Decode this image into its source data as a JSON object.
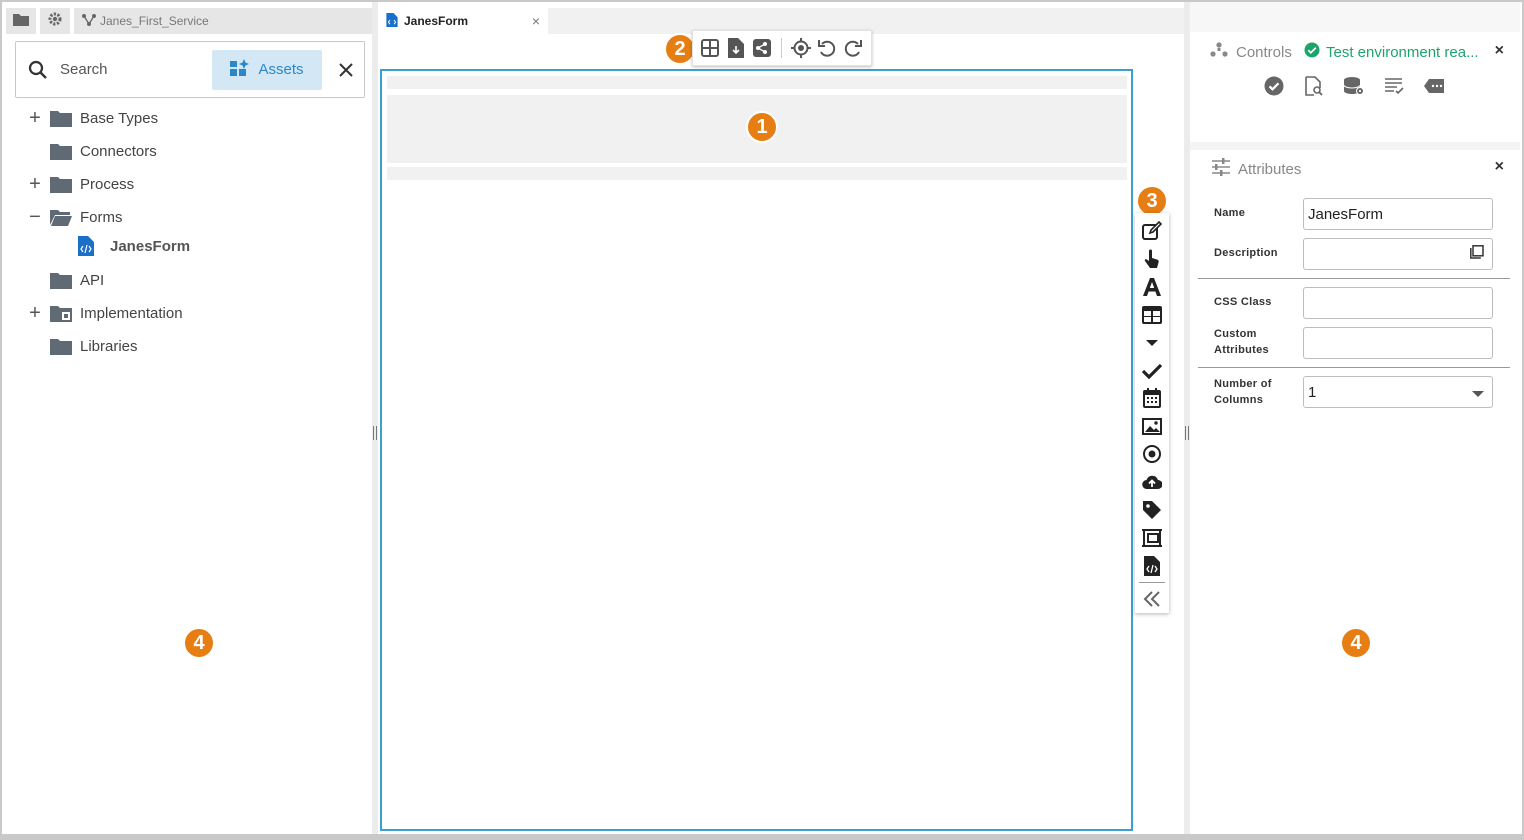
{
  "left": {
    "service_tab": "Janes_First_Service",
    "search": {
      "placeholder": "Search",
      "assets_label": "Assets"
    },
    "tree": [
      {
        "label": "Base Types",
        "expander": "+"
      },
      {
        "label": "Connectors",
        "expander": ""
      },
      {
        "label": "Process",
        "expander": "+"
      },
      {
        "label": "Forms",
        "expander": "−"
      },
      {
        "label": "JanesForm",
        "expander": ""
      },
      {
        "label": "API",
        "expander": ""
      },
      {
        "label": "Implementation",
        "expander": "+"
      },
      {
        "label": "Libraries",
        "expander": ""
      }
    ]
  },
  "center": {
    "tab_label": "JanesForm",
    "tab_close": "×"
  },
  "right": {
    "controls_title": "Controls",
    "test_env": "Test environment rea...",
    "attributes_title": "Attributes",
    "fields": {
      "name_label": "Name",
      "name_value": "JanesForm",
      "description_label": "Description",
      "description_value": "",
      "css_label": "CSS Class",
      "css_value": "",
      "custom_label_1": "Custom",
      "custom_label_2": "Attributes",
      "custom_value": "",
      "columns_label_1": "Number of",
      "columns_label_2": "Columns",
      "columns_value": "1"
    },
    "close": "×"
  },
  "badges": {
    "b1": "1",
    "b2": "2",
    "b3": "3",
    "b4": "4"
  },
  "colors": {
    "accent": "#3aa0d3",
    "badge": "#e67e14",
    "success": "#1ca46c",
    "assets_bg": "#d4e7f5"
  }
}
